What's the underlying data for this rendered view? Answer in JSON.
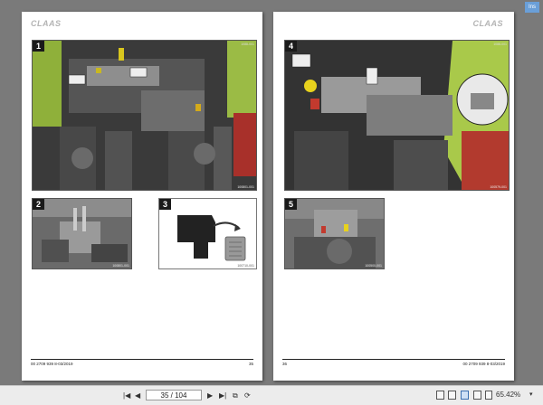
{
  "app": {
    "corner_badge": "Ins"
  },
  "left_page": {
    "logo": "CLAAS",
    "footer_doc": "00 2709 939 8-03/2019",
    "footer_page": "35",
    "figures": [
      {
        "number": "1",
        "code": "1088-001",
        "ref": "100801-001"
      },
      {
        "number": "2",
        "code": "",
        "ref": "100801-001"
      },
      {
        "number": "3",
        "code": "",
        "ref": "100710-001"
      }
    ]
  },
  "right_page": {
    "logo": "CLAAS",
    "footer_doc": "00 2709 939 8-03/2019",
    "footer_page": "36",
    "figures": [
      {
        "number": "4",
        "code": "1088-001",
        "ref": "100579-001"
      },
      {
        "number": "5",
        "code": "",
        "ref": "100500-001"
      }
    ]
  },
  "toolbar": {
    "page_indicator": "35 / 104",
    "zoom": "65.42%",
    "icons": {
      "first": "first-page-icon",
      "prev": "prev-page-icon",
      "next": "next-page-icon",
      "last": "last-page-icon",
      "copy": "copy-icon",
      "rotate": "rotate-icon"
    }
  },
  "colors": {
    "background": "#7a7a7a",
    "claas_green": "#a9c94a",
    "accent_red": "#c23a2e",
    "accent_yellow": "#e8d21d"
  }
}
